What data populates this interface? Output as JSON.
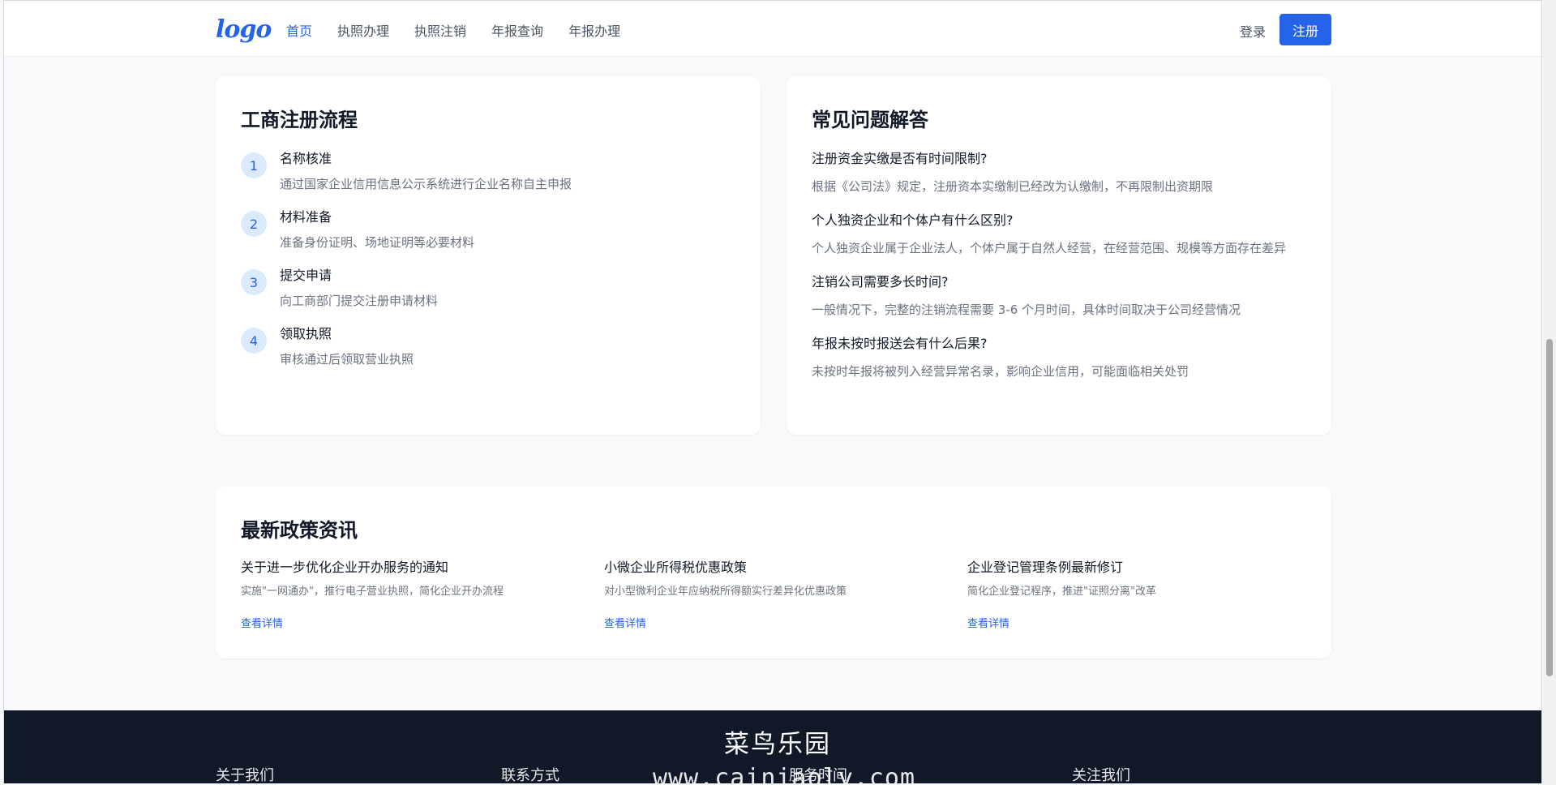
{
  "header": {
    "logo": "logo",
    "nav": [
      "首页",
      "执照办理",
      "执照注销",
      "年报查询",
      "年报办理"
    ],
    "login": "登录",
    "register": "注册"
  },
  "process": {
    "title": "工商注册流程",
    "steps": [
      {
        "num": "1",
        "title": "名称核准",
        "desc": "通过国家企业信用信息公示系统进行企业名称自主申报"
      },
      {
        "num": "2",
        "title": "材料准备",
        "desc": "准备身份证明、场地证明等必要材料"
      },
      {
        "num": "3",
        "title": "提交申请",
        "desc": "向工商部门提交注册申请材料"
      },
      {
        "num": "4",
        "title": "领取执照",
        "desc": "审核通过后领取营业执照"
      }
    ]
  },
  "faq": {
    "title": "常见问题解答",
    "items": [
      {
        "q": "注册资金实缴是否有时间限制?",
        "a": "根据《公司法》规定，注册资本实缴制已经改为认缴制，不再限制出资期限"
      },
      {
        "q": "个人独资企业和个体户有什么区别?",
        "a": "个人独资企业属于企业法人，个体户属于自然人经营，在经营范围、规模等方面存在差异"
      },
      {
        "q": "注销公司需要多长时间?",
        "a": "一般情况下，完整的注销流程需要 3-6 个月时间，具体时间取决于公司经营情况"
      },
      {
        "q": "年报未按时报送会有什么后果?",
        "a": "未按时年报将被列入经营异常名录，影响企业信用，可能面临相关处罚"
      }
    ]
  },
  "news": {
    "title": "最新政策资讯",
    "items": [
      {
        "title": "关于进一步优化企业开办服务的通知",
        "desc": "实施\"一网通办\"，推行电子营业执照，简化企业开办流程",
        "link": "查看详情"
      },
      {
        "title": "小微企业所得税优惠政策",
        "desc": "对小型微利企业年应纳税所得额实行差异化优惠政策",
        "link": "查看详情"
      },
      {
        "title": "企业登记管理条例最新修订",
        "desc": "简化企业登记程序，推进\"证照分离\"改革",
        "link": "查看详情"
      }
    ]
  },
  "footer": {
    "cols": [
      "关于我们",
      "联系方式",
      "服务时间",
      "关注我们"
    ],
    "watermark_title": "菜鸟乐园",
    "watermark_url": "www.cainiaoly.com"
  }
}
